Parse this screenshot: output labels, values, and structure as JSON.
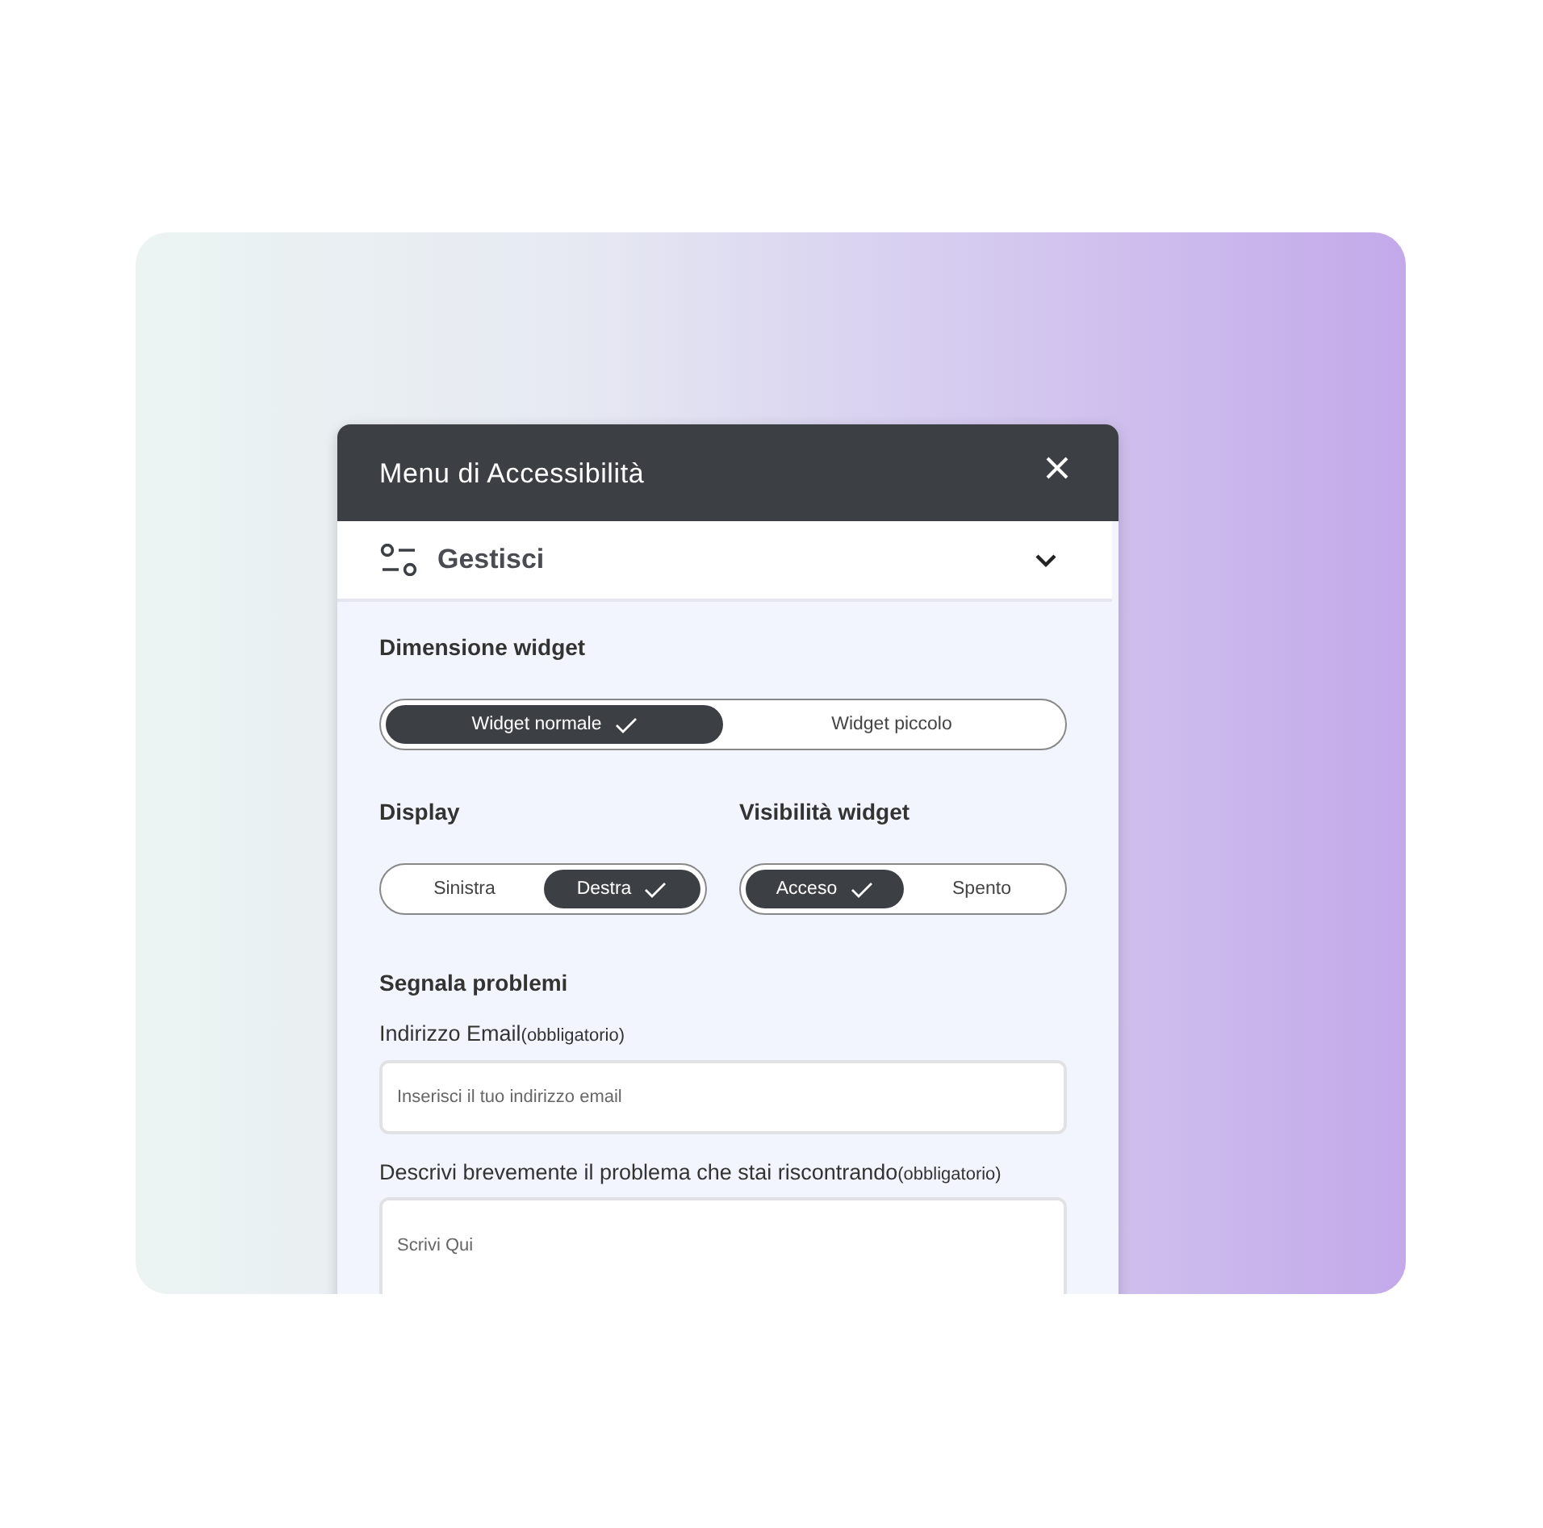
{
  "window": {
    "title": "Menu di Accessibilità"
  },
  "section": {
    "title": "Gestisci",
    "expanded": true
  },
  "size": {
    "label": "Dimensione widget",
    "options": [
      {
        "label": "Widget normale",
        "selected": true
      },
      {
        "label": "Widget piccolo",
        "selected": false
      }
    ]
  },
  "display": {
    "label": "Display",
    "options": [
      {
        "label": "Sinistra",
        "selected": false
      },
      {
        "label": "Destra",
        "selected": true
      }
    ]
  },
  "visibility": {
    "label": "Visibilità widget",
    "options": [
      {
        "label": "Acceso",
        "selected": true
      },
      {
        "label": "Spento",
        "selected": false
      }
    ]
  },
  "report": {
    "title": "Segnala problemi",
    "fields": [
      {
        "kind": "input",
        "label": "Indirizzo Email",
        "note": "(obbligatorio)",
        "placeholder": "Inserisci il tuo indirizzo email"
      },
      {
        "kind": "textarea",
        "label": "Descrivi brevemente il problema che stai riscontrando",
        "note": "(obbligatorio)",
        "placeholder": "Scrivi Qui"
      }
    ]
  }
}
